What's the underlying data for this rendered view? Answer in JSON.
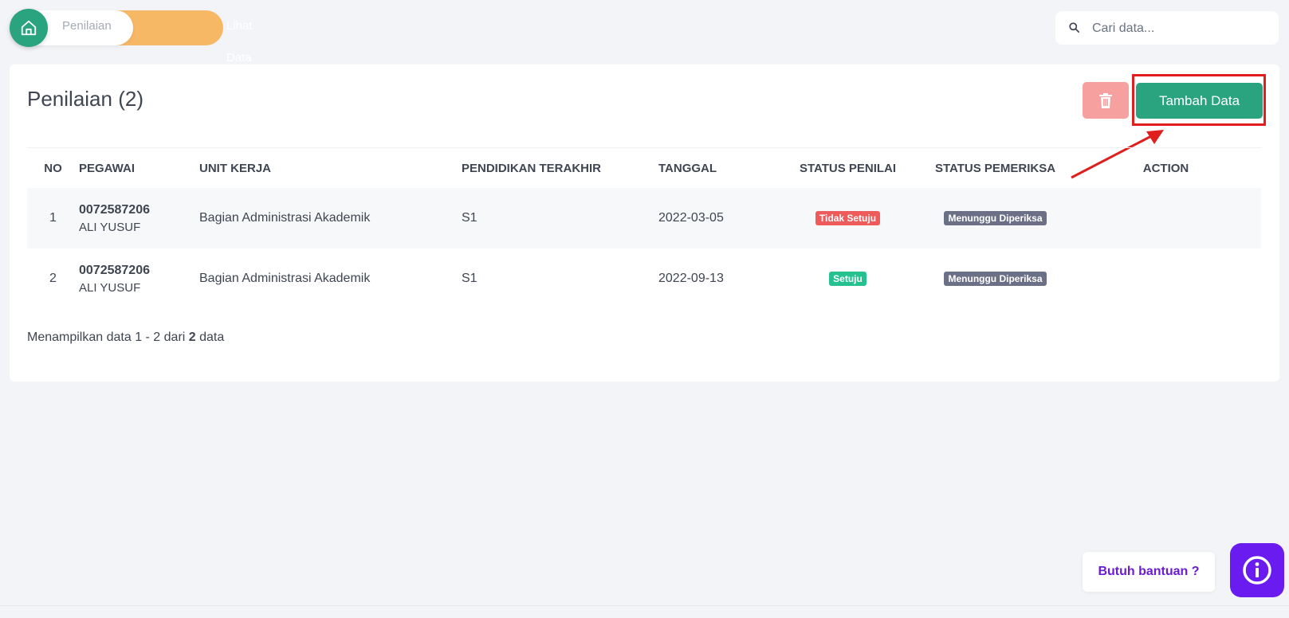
{
  "breadcrumb": {
    "items": [
      {
        "label": "Penilaian"
      },
      {
        "label": "Lihat Data"
      }
    ],
    "home_icon": "home-icon"
  },
  "search": {
    "placeholder": "Cari data...",
    "value": "",
    "icon": "search-icon"
  },
  "card": {
    "title": "Penilaian (2)",
    "delete_icon": "trash-icon",
    "add_label": "Tambah Data",
    "colors": {
      "primary": "#2aa37f",
      "danger_soft": "#f6a0a0",
      "accent_orange": "#f7b866",
      "annotation_red": "#e01e1e"
    }
  },
  "table": {
    "headers": {
      "no": "NO",
      "pegawai": "PEGAWAI",
      "unit_kerja": "UNIT KERJA",
      "pendidikan": "PENDIDIKAN TERAKHIR",
      "tanggal": "TANGGAL",
      "status_penilai": "STATUS PENILAI",
      "status_pemeriksa": "STATUS PEMERIKSA",
      "action": "ACTION"
    },
    "rows": [
      {
        "no": "1",
        "nip": "0072587206",
        "nama": "ALI YUSUF",
        "unit_kerja": "Bagian Administrasi Akademik",
        "pendidikan": "S1",
        "tanggal": "2022-03-05",
        "status_penilai": "Tidak Setuju",
        "status_pemeriksa": "Menunggu Diperiksa"
      },
      {
        "no": "2",
        "nip": "0072587206",
        "nama": "ALI YUSUF",
        "unit_kerja": "Bagian Administrasi Akademik",
        "pendidikan": "S1",
        "tanggal": "2022-09-13",
        "status_penilai": "Setuju",
        "status_pemeriksa": "Menunggu Diperiksa"
      }
    ]
  },
  "pagination": {
    "prefix": "Menampilkan data 1 - 2 dari ",
    "total": "2",
    "suffix": " data"
  },
  "help": {
    "label": "Butuh bantuan ?",
    "icon": "info-icon",
    "color": "#6a1bf0"
  }
}
